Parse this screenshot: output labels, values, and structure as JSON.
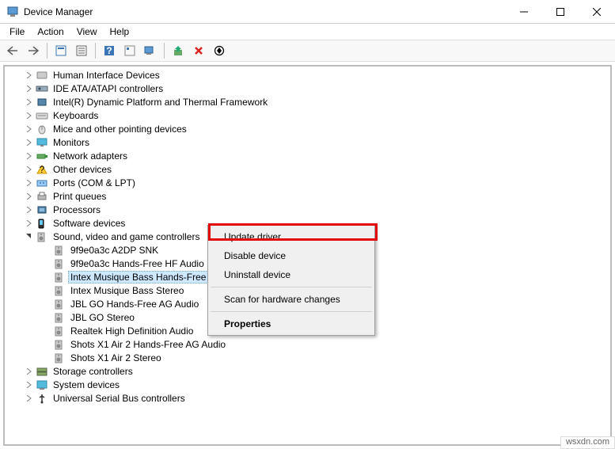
{
  "window": {
    "title": "Device Manager"
  },
  "menu": {
    "file": "File",
    "action": "Action",
    "view": "View",
    "help": "Help"
  },
  "tree": {
    "categories": [
      {
        "label": "Human Interface Devices",
        "icon": "hid"
      },
      {
        "label": "IDE ATA/ATAPI controllers",
        "icon": "ide"
      },
      {
        "label": "Intel(R) Dynamic Platform and Thermal Framework",
        "icon": "chip"
      },
      {
        "label": "Keyboards",
        "icon": "keyboard"
      },
      {
        "label": "Mice and other pointing devices",
        "icon": "mouse"
      },
      {
        "label": "Monitors",
        "icon": "monitor"
      },
      {
        "label": "Network adapters",
        "icon": "network"
      },
      {
        "label": "Other devices",
        "icon": "other"
      },
      {
        "label": "Ports (COM & LPT)",
        "icon": "port"
      },
      {
        "label": "Print queues",
        "icon": "printer"
      },
      {
        "label": "Processors",
        "icon": "cpu"
      },
      {
        "label": "Software devices",
        "icon": "software"
      }
    ],
    "sound_category": {
      "label": "Sound, video and game controllers"
    },
    "sound_children": [
      {
        "label": "9f9e0a3c A2DP SNK"
      },
      {
        "label": "9f9e0a3c Hands-Free HF Audio"
      },
      {
        "label": "Intex Musique Bass Hands-Free AG Audio",
        "selected": true
      },
      {
        "label": "Intex Musique Bass Stereo"
      },
      {
        "label": "JBL GO Hands-Free AG Audio"
      },
      {
        "label": "JBL GO Stereo"
      },
      {
        "label": "Realtek High Definition Audio"
      },
      {
        "label": "Shots X1 Air 2 Hands-Free AG Audio"
      },
      {
        "label": "Shots X1 Air 2 Stereo"
      }
    ],
    "tail_categories": [
      {
        "label": "Storage controllers",
        "icon": "storage"
      },
      {
        "label": "System devices",
        "icon": "system"
      },
      {
        "label": "Universal Serial Bus controllers",
        "icon": "usb"
      }
    ]
  },
  "context_menu": {
    "update": "Update driver",
    "disable": "Disable device",
    "uninstall": "Uninstall device",
    "scan": "Scan for hardware changes",
    "properties": "Properties"
  },
  "watermark": "wsxdn.com"
}
